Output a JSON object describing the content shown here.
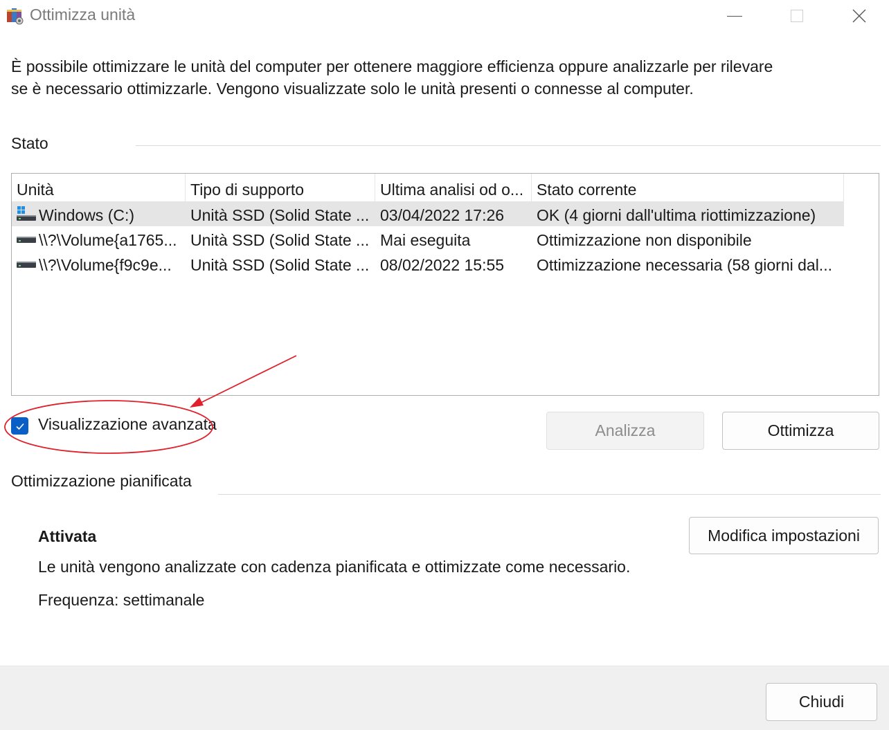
{
  "window": {
    "title": "Ottimizza unità",
    "icon": "defrag-app-icon",
    "controls": [
      "minimize-icon",
      "maximize-icon",
      "close-icon"
    ]
  },
  "description": {
    "line1": "È possibile ottimizzare le unità del computer per ottenere maggiore efficienza oppure analizzarle per rilevare",
    "line2": "se è necessario ottimizzarle. Vengono visualizzate solo le unità presenti o connesse al computer."
  },
  "status_section": {
    "label": "Stato"
  },
  "drives_table": {
    "columns": [
      "Unità",
      "Tipo di supporto",
      "Ultima analisi od o...",
      "Stato corrente"
    ],
    "rows": [
      {
        "name": "Windows (C:)",
        "media": "Unità SSD (Solid State ...",
        "last": "03/04/2022 17:26",
        "status": "OK (4 giorni dall'ultima riottimizzazione)",
        "icon": "windows-drive-icon",
        "selected": true
      },
      {
        "name": "\\\\?\\Volume{a1765...",
        "media": "Unità SSD (Solid State ...",
        "last": "Mai eseguita",
        "status": "Ottimizzazione non disponibile",
        "icon": "drive-icon",
        "selected": false
      },
      {
        "name": "\\\\?\\Volume{f9c9e...",
        "media": "Unità SSD (Solid State ...",
        "last": "08/02/2022 15:55",
        "status": "Ottimizzazione necessaria (58 giorni dal...",
        "icon": "drive-icon",
        "selected": false
      }
    ]
  },
  "advanced_view": {
    "label": "Visualizzazione avanzata",
    "checked": true
  },
  "actions": {
    "analyze_label": "Analizza",
    "analyze_enabled": false,
    "optimize_label": "Ottimizza"
  },
  "scheduled": {
    "label": "Ottimizzazione pianificata",
    "state": "Attivata",
    "description": "Le unità vengono analizzate con cadenza pianificata e ottimizzate come necessario.",
    "frequency": "Frequenza: settimanale",
    "change_settings_label": "Modifica impostazioni"
  },
  "footer": {
    "close_label": "Chiudi"
  },
  "colors": {
    "accent": "#0a5fc6",
    "annotation": "#e0202a",
    "selection": "#e5e5e5"
  }
}
